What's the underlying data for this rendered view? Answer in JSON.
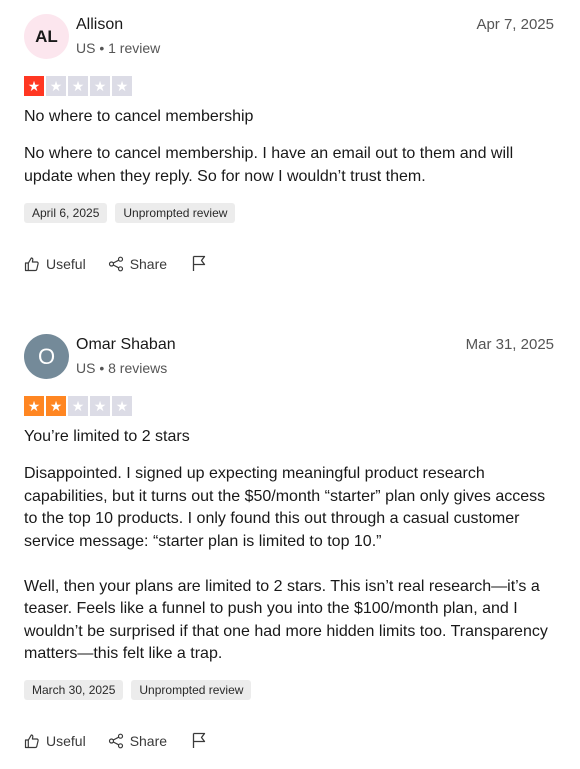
{
  "reviews": [
    {
      "avatar_initials": "AL",
      "name": "Allison",
      "meta": "US • 1 review",
      "date": "Apr 7, 2025",
      "rating": 1,
      "star_color": "#ff3722",
      "title": "No where to cancel membership",
      "body": [
        "No where to cancel membership. I have an email out to them and will update when they reply. So for now I wouldn’t trust them."
      ],
      "tags": [
        "April 6, 2025",
        "Unprompted review"
      ],
      "actions": {
        "useful": "Useful",
        "share": "Share"
      }
    },
    {
      "avatar_initials": "O",
      "name": "Omar Shaban",
      "meta": "US • 8 reviews",
      "date": "Mar 31, 2025",
      "rating": 2,
      "star_color": "#ff8622",
      "title": "You’re limited to 2 stars",
      "body": [
        "Disappointed. I signed up expecting meaningful product research capabilities, but it turns out the $50/month “starter” plan only gives access to the top 10 products. I only found this out through a casual customer service message: “starter plan is limited to top 10.”",
        "Well, then your plans are limited to 2 stars. This isn’t real research—it’s a teaser. Feels like a funnel to push you into the $100/month plan, and I wouldn’t be surprised if that one had more hidden limits too. Transparency matters—this felt like a trap."
      ],
      "tags": [
        "March 30, 2025",
        "Unprompted review"
      ],
      "actions": {
        "useful": "Useful",
        "share": "Share"
      }
    }
  ],
  "icons": {
    "star": "star-icon",
    "useful": "thumbs-up-icon",
    "share": "share-icon",
    "flag": "flag-icon"
  }
}
